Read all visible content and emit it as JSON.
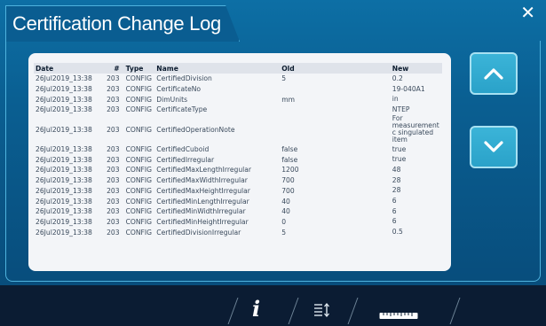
{
  "window": {
    "title": "Certification Change Log",
    "close_glyph": "✕"
  },
  "table": {
    "headers": {
      "date": "Date",
      "num": "#",
      "type": "Type",
      "name": "Name",
      "old": "Old",
      "new": "New"
    },
    "rows": [
      {
        "date": "26Jul2019_13:38",
        "num": "203",
        "type": "CONFIG",
        "name": "CertifiedDivision",
        "old": "5",
        "new": "0.2"
      },
      {
        "date": "26Jul2019_13:38",
        "num": "203",
        "type": "CONFIG",
        "name": "CertificateNo",
        "old": "",
        "new": "19-040A1"
      },
      {
        "date": "26Jul2019_13:38",
        "num": "203",
        "type": "CONFIG",
        "name": "DimUnits",
        "old": "mm",
        "new": "in"
      },
      {
        "date": "26Jul2019_13:38",
        "num": "203",
        "type": "CONFIG",
        "name": "CertificateType",
        "old": "",
        "new": "NTEP"
      },
      {
        "date": "26Jul2019_13:38",
        "num": "203",
        "type": "CONFIG",
        "name": "CertifiedOperationNote",
        "old": "",
        "new": "For measurement c singulated item"
      },
      {
        "date": "26Jul2019_13:38",
        "num": "203",
        "type": "CONFIG",
        "name": "CertifiedCuboid",
        "old": "false",
        "new": "true"
      },
      {
        "date": "26Jul2019_13:38",
        "num": "203",
        "type": "CONFIG",
        "name": "CertifiedIrregular",
        "old": "false",
        "new": "true"
      },
      {
        "date": "26Jul2019_13:38",
        "num": "203",
        "type": "CONFIG",
        "name": "CertifiedMaxLengthIrregular",
        "old": "1200",
        "new": "48"
      },
      {
        "date": "26Jul2019_13:38",
        "num": "203",
        "type": "CONFIG",
        "name": "CertifiedMaxWidthIrregular",
        "old": "700",
        "new": "28"
      },
      {
        "date": "26Jul2019_13:38",
        "num": "203",
        "type": "CONFIG",
        "name": "CertifiedMaxHeightIrregular",
        "old": "700",
        "new": "28"
      },
      {
        "date": "26Jul2019_13:38",
        "num": "203",
        "type": "CONFIG",
        "name": "CertifiedMinLengthIrregular",
        "old": "40",
        "new": "6"
      },
      {
        "date": "26Jul2019_13:38",
        "num": "203",
        "type": "CONFIG",
        "name": "CertifiedMinWidthIrregular",
        "old": "40",
        "new": "6"
      },
      {
        "date": "26Jul2019_13:38",
        "num": "203",
        "type": "CONFIG",
        "name": "CertifiedMinHeightIrregular",
        "old": "0",
        "new": "6"
      },
      {
        "date": "26Jul2019_13:38",
        "num": "203",
        "type": "CONFIG",
        "name": "CertifiedDivisionIrregular",
        "old": "5",
        "new": "0.5"
      }
    ]
  },
  "nav": {
    "up_icon": "chevron-up-icon",
    "down_icon": "chevron-down-icon"
  },
  "toolbar": {
    "info_glyph": "i",
    "info_icon": "info-icon",
    "sort_icon": "sort-list-icon",
    "ruler_icon": "ruler-icon"
  },
  "colors": {
    "panel": "#0a5f92",
    "accent_border": "#4fb3de",
    "nav_button": "#2fa8cf",
    "toolbar_bg": "#0b1c33"
  }
}
